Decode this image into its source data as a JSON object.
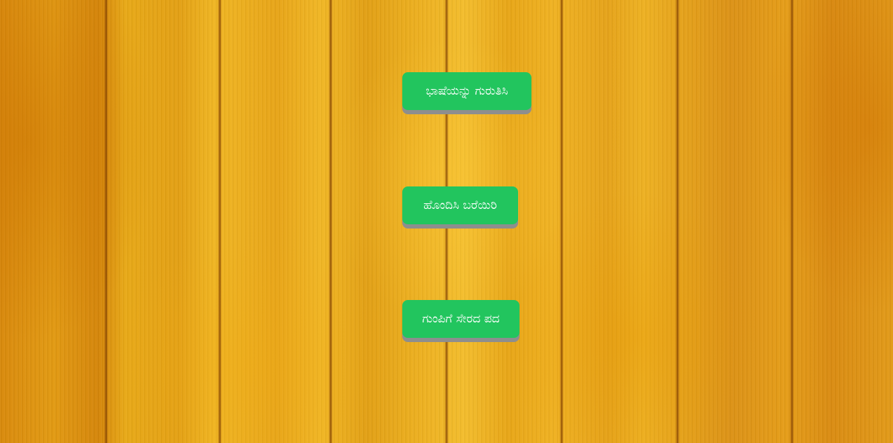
{
  "menu": {
    "buttons": [
      {
        "label": "ಭಾಷೆಯನ್ನು ಗುರುತಿಸಿ"
      },
      {
        "label": "ಹೊಂದಿಸಿ ಬರೆಯಿರಿ"
      },
      {
        "label": "ಗುಂಪಿಗೆ ಸೇರದ ಪದ"
      }
    ]
  },
  "colors": {
    "button_bg": "#22c55e",
    "button_shadow": "#8e8e8e",
    "button_text": "#ffffff",
    "background": "#e8a517"
  }
}
